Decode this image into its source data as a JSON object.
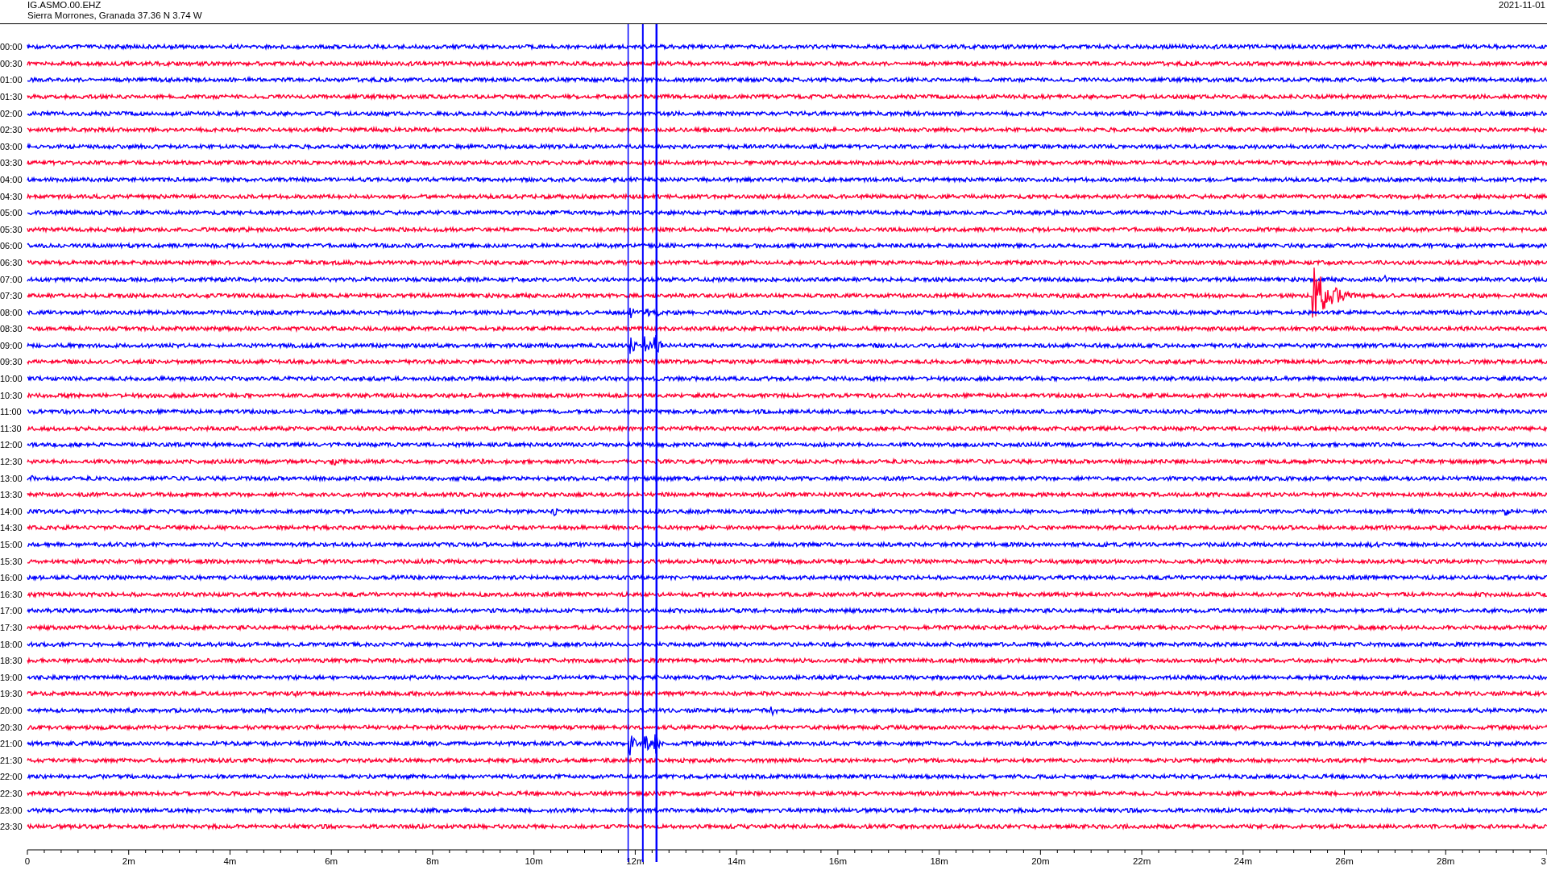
{
  "header": {
    "station": "IG.ASMO.00.EHZ",
    "location": "Sierra Morrones, Granada  37.36 N 3.74 W",
    "date": "2021-11-01"
  },
  "rows": [
    {
      "label": "00:00",
      "color": "#0000ff"
    },
    {
      "label": "00:30",
      "color": "#ff0033"
    },
    {
      "label": "01:00",
      "color": "#0000ff"
    },
    {
      "label": "01:30",
      "color": "#ff0033"
    },
    {
      "label": "02:00",
      "color": "#0000ff"
    },
    {
      "label": "02:30",
      "color": "#ff0033"
    },
    {
      "label": "03:00",
      "color": "#0000ff"
    },
    {
      "label": "03:30",
      "color": "#ff0033"
    },
    {
      "label": "04:00",
      "color": "#0000ff"
    },
    {
      "label": "04:30",
      "color": "#ff0033"
    },
    {
      "label": "05:00",
      "color": "#0000ff"
    },
    {
      "label": "05:30",
      "color": "#ff0033"
    },
    {
      "label": "06:00",
      "color": "#0000ff"
    },
    {
      "label": "06:30",
      "color": "#ff0033"
    },
    {
      "label": "07:00",
      "color": "#0000ff"
    },
    {
      "label": "07:30",
      "color": "#ff0033"
    },
    {
      "label": "08:00",
      "color": "#0000ff"
    },
    {
      "label": "08:30",
      "color": "#ff0033"
    },
    {
      "label": "09:00",
      "color": "#0000ff"
    },
    {
      "label": "09:30",
      "color": "#ff0033"
    },
    {
      "label": "10:00",
      "color": "#0000ff"
    },
    {
      "label": "10:30",
      "color": "#ff0033"
    },
    {
      "label": "11:00",
      "color": "#0000ff"
    },
    {
      "label": "11:30",
      "color": "#ff0033"
    },
    {
      "label": "12:00",
      "color": "#0000ff"
    },
    {
      "label": "12:30",
      "color": "#ff0033"
    },
    {
      "label": "13:00",
      "color": "#0000ff"
    },
    {
      "label": "13:30",
      "color": "#ff0033"
    },
    {
      "label": "14:00",
      "color": "#0000ff"
    },
    {
      "label": "14:30",
      "color": "#ff0033"
    },
    {
      "label": "15:00",
      "color": "#0000ff"
    },
    {
      "label": "15:30",
      "color": "#ff0033"
    },
    {
      "label": "16:00",
      "color": "#0000ff"
    },
    {
      "label": "16:30",
      "color": "#ff0033"
    },
    {
      "label": "17:00",
      "color": "#0000ff"
    },
    {
      "label": "17:30",
      "color": "#ff0033"
    },
    {
      "label": "18:00",
      "color": "#0000ff"
    },
    {
      "label": "18:30",
      "color": "#ff0033"
    },
    {
      "label": "19:00",
      "color": "#0000ff"
    },
    {
      "label": "19:30",
      "color": "#ff0033"
    },
    {
      "label": "20:00",
      "color": "#0000ff"
    },
    {
      "label": "20:30",
      "color": "#ff0033"
    },
    {
      "label": "21:00",
      "color": "#0000ff"
    },
    {
      "label": "21:30",
      "color": "#ff0033"
    },
    {
      "label": "22:00",
      "color": "#0000ff"
    },
    {
      "label": "22:30",
      "color": "#ff0033"
    },
    {
      "label": "23:00",
      "color": "#0000ff"
    },
    {
      "label": "23:30",
      "color": "#ff0033"
    }
  ],
  "x_axis": {
    "labels": [
      "0",
      "2m",
      "4m",
      "6m",
      "8m",
      "10m",
      "12m",
      "14m",
      "16m",
      "18m",
      "20m",
      "22m",
      "24m",
      "26m",
      "28m",
      "3"
    ]
  }
}
